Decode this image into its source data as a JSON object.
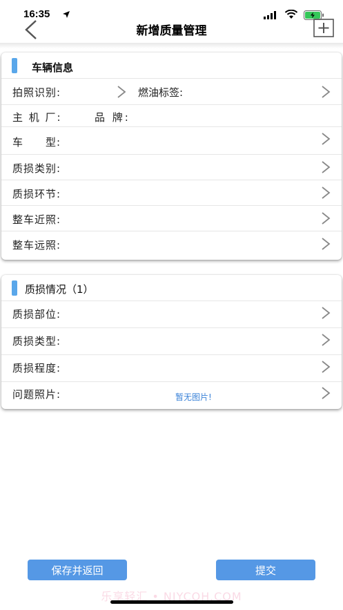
{
  "status_bar": {
    "time": "16:35"
  },
  "nav": {
    "title": "新增质量管理"
  },
  "vehicle_card": {
    "title": "车辆信息",
    "plate_label": "拍照识别:",
    "fuel_label": "燃油标签:",
    "maker_label": "主 机 厂:",
    "brand_label": "品 牌:",
    "model_label": "车　　型:",
    "damage_type_label": "质损类别:",
    "damage_stage_label": "质损环节:",
    "near_photo_label": "整车近照:",
    "far_photo_label": "整车远照:"
  },
  "damage_card": {
    "title": "质损情况（1）",
    "part_label": "质损部位:",
    "kind_label": "质损类型:",
    "degree_label": "质损程度:",
    "photo_label": "问题照片:",
    "no_photo": "暂无图片!"
  },
  "buttons": {
    "save": "保存并返回",
    "submit": "提交"
  },
  "watermark": "乐享轻汇 • NJYCOH.COM",
  "colors": {
    "accent": "#5aa7ea",
    "button": "#5598e5",
    "link": "#3a82d8"
  }
}
